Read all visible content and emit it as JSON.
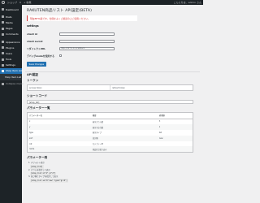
{
  "adminbar": {
    "items": [
      "",
      "ショップ",
      "0",
      "+ 新規"
    ],
    "right": "こんにちは、admin さん"
  },
  "sidebar": {
    "items": [
      {
        "label": "Dashboard",
        "icon": "dashboard-icon"
      },
      {
        "label": "Posts",
        "icon": "pin-icon"
      },
      {
        "label": "Media",
        "icon": "media-icon"
      },
      {
        "label": "Pages",
        "icon": "page-icon"
      },
      {
        "label": "Comments",
        "icon": "comment-icon"
      },
      {
        "label": "Appearance",
        "icon": "brush-icon"
      },
      {
        "label": "Plugins",
        "icon": "plugin-icon"
      },
      {
        "label": "Users",
        "icon": "user-icon"
      },
      {
        "label": "Tools",
        "icon": "wrench-icon"
      },
      {
        "label": "Settings",
        "icon": "settings-icon"
      },
      {
        "label": "Shop Item List",
        "icon": "list-icon"
      }
    ],
    "submenu": [
      "Shop Item List"
    ],
    "collapse": "Collapse menu"
  },
  "page": {
    "title": "RAKUTEN商品リスト API設定(BETA)",
    "notice": "現在BETA版です。仕様をよくご確認の上ご使用ください。",
    "settings_title": "settings",
    "fields": [
      {
        "label": "client id",
        "value": ""
      },
      {
        "label": "client secret",
        "value": ""
      },
      {
        "label": "リダイレクトURL",
        "value": "http://127.0.0.1/callback"
      },
      {
        "label": "デバッグmodeを使用する",
        "value": ""
      }
    ],
    "save_button": "Save Changes",
    "api_auth_title": "API認証",
    "token_title": "トークン",
    "token_cells": [
      "access token",
      "refresh token"
    ],
    "shortcode_title": "ショートコード",
    "shortcode_value": "[shop_list]",
    "params_title": "パラメーター一覧",
    "params_headers": [
      "パラメーター名",
      "概要",
      "初期値"
    ],
    "params_rows": [
      [
        "x",
        "表示カラム数",
        "3"
      ],
      [
        "y",
        "表示する行数",
        "1"
      ],
      [
        "type",
        "表示タイプ",
        "list"
      ],
      [
        "sort",
        "並び順",
        "new"
      ],
      [
        "cat",
        "カテゴリーID",
        ""
      ],
      [
        "name",
        "商品名で絞り込み",
        ""
      ]
    ],
    "example_title": "パラメーター例",
    "examples": [
      {
        "text": "1. デフォルト表示",
        "code": "[shop_list]"
      },
      {
        "text": "2. カラムを指定して表示",
        "code": "[shop_list x=\"4\" y=\"2\"]"
      },
      {
        "text": "3. 並び順とタイプを指定して表示",
        "code": "[shop_list sort=\"new\" type=\"grid\"]"
      }
    ]
  }
}
